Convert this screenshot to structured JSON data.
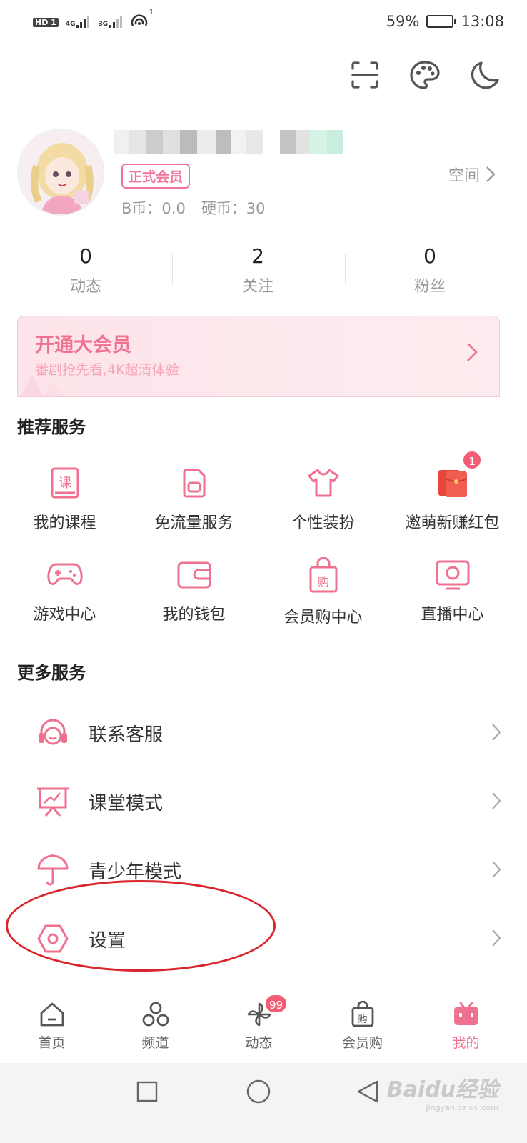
{
  "status_bar": {
    "network_left": "HD 1",
    "net_4g": "4G",
    "net_3g": "3G",
    "hotspot_count": "1",
    "battery": "59%",
    "battery_level": 0.59,
    "time": "13:08"
  },
  "profile": {
    "vip_badge": "正式会员",
    "b_coin": "B币：0.0",
    "coin": "硬币：30",
    "space_label": "空间"
  },
  "stats": [
    {
      "value": "0",
      "label": "动态"
    },
    {
      "value": "2",
      "label": "关注"
    },
    {
      "value": "0",
      "label": "粉丝"
    }
  ],
  "vip_banner": {
    "title": "开通大会员",
    "subtitle": "番剧抢先看,4K超清体验"
  },
  "recommended": {
    "title": "推荐服务",
    "items": [
      {
        "label": "我的课程",
        "icon": "course-icon"
      },
      {
        "label": "免流量服务",
        "icon": "sim-card-icon"
      },
      {
        "label": "个性装扮",
        "icon": "tshirt-icon"
      },
      {
        "label": "邀萌新赚红包",
        "icon": "red-envelope-icon",
        "badge": "1"
      },
      {
        "label": "游戏中心",
        "icon": "gamepad-icon"
      },
      {
        "label": "我的钱包",
        "icon": "wallet-icon"
      },
      {
        "label": "会员购中心",
        "icon": "shopping-bag-icon"
      },
      {
        "label": "直播中心",
        "icon": "tv-icon"
      }
    ]
  },
  "more": {
    "title": "更多服务",
    "items": [
      {
        "label": "联系客服",
        "icon": "headset-icon"
      },
      {
        "label": "课堂模式",
        "icon": "presentation-icon"
      },
      {
        "label": "青少年模式",
        "icon": "umbrella-icon"
      },
      {
        "label": "设置",
        "icon": "settings-icon"
      }
    ]
  },
  "bottom_nav": [
    {
      "label": "首页",
      "icon": "home-icon"
    },
    {
      "label": "频道",
      "icon": "channel-icon"
    },
    {
      "label": "动态",
      "icon": "pinwheel-icon",
      "badge": "99"
    },
    {
      "label": "会员购",
      "icon": "shopping-bag-icon"
    },
    {
      "label": "我的",
      "icon": "bilibili-tv-icon",
      "active": true
    }
  ],
  "watermark": {
    "brand": "Baidu经验",
    "url": "jingyan.baidu.com"
  },
  "colors": {
    "accent": "#f07090",
    "badge": "#f25d75",
    "highlight_oval": "#d9262c"
  }
}
